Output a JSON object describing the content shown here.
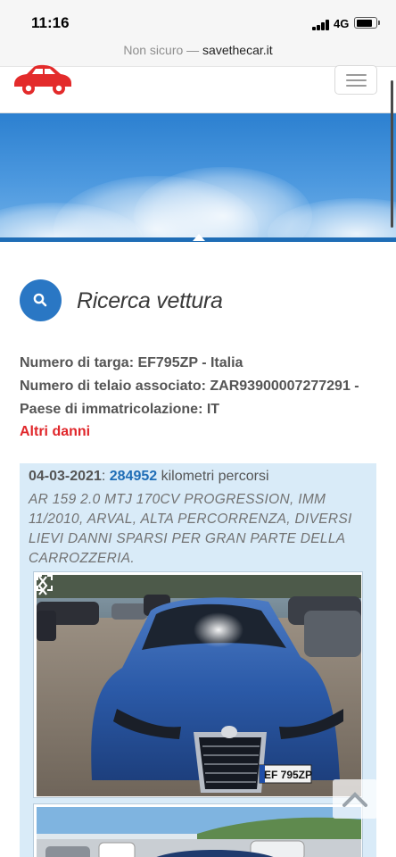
{
  "status_bar": {
    "time": "11:16",
    "network": "4G",
    "battery_level": 0.85
  },
  "browser": {
    "insecure_label": "Non sicuro",
    "separator": " — ",
    "domain": "savethecar.it"
  },
  "colors": {
    "brand_blue": "#2a77c4",
    "link_blue": "#1f6db6",
    "alert_red": "#e0262a",
    "record_bg": "#d9ebf8"
  },
  "search": {
    "icon": "search-icon",
    "title": "Ricerca vettura"
  },
  "vehicle": {
    "plate_line": "Numero di targa: EF795ZP - Italia",
    "vin_line": "Numero di telaio associato: ZAR93900007277291 -",
    "country_line": "Paese di immatricolazione: IT",
    "damage_link": "Altri danni"
  },
  "record": {
    "date": "04-03-2021",
    "colon": ":",
    "km": "284952",
    "km_suffix": "kilometri percorsi",
    "description": "AR 159 2.0 MTJ 170CV PROGRESSION, IMM 11/2010, ARVAL, ALTA PERCORRENZA, DIVERSI LIEVI DANNI SPARSI PER GRAN PARTE DELLA CARROZZERIA.",
    "plate_in_photo": "EF 795ZP"
  }
}
